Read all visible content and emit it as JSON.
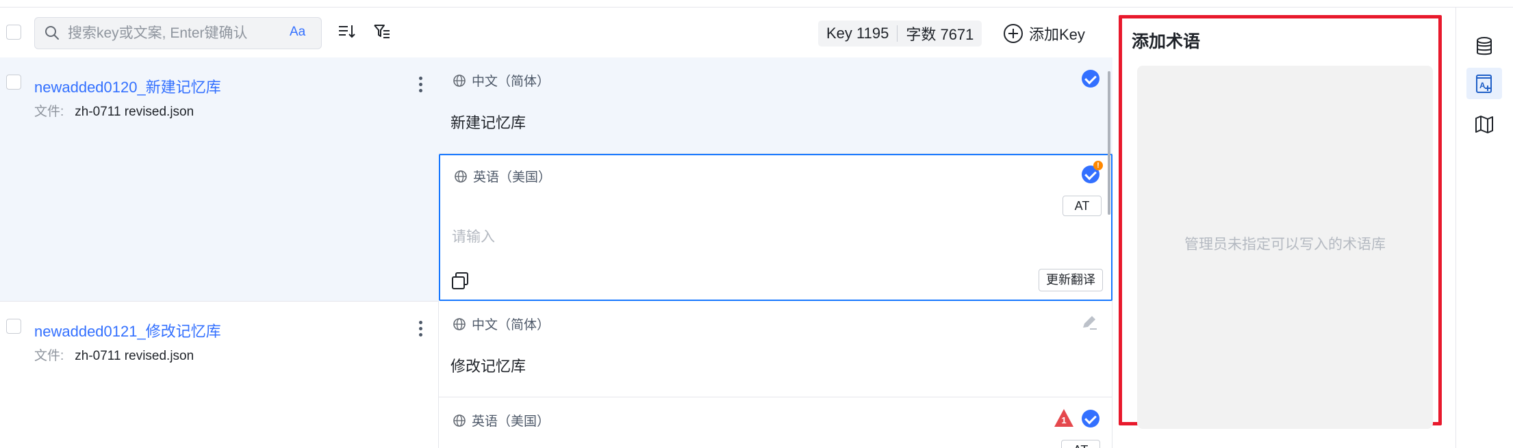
{
  "toolbar": {
    "search_placeholder": "搜索key或文案, Enter键确认",
    "case_toggle": "Aa",
    "key_count": "Key 1195",
    "word_count": "字数 7671",
    "add_key_label": "添加Key"
  },
  "keys": [
    {
      "name": "newadded0120_新建记忆库",
      "file_label": "文件:",
      "file": "zh-0711 revised.json"
    },
    {
      "name": "newadded0121_修改记忆库",
      "file_label": "文件:",
      "file": "zh-0711 revised.json"
    }
  ],
  "translations": {
    "row1_zh": {
      "lang": "中文（简体）",
      "value": "新建记忆库"
    },
    "row1_en": {
      "lang": "英语（美国）",
      "placeholder": "请输入",
      "at_button": "AT",
      "update_button": "更新翻译",
      "warning_count": "!"
    },
    "row2_zh": {
      "lang": "中文（简体）",
      "value": "修改记忆库"
    },
    "row2_en": {
      "lang": "英语（美国）",
      "at_button": "AT",
      "alert_count": "1"
    }
  },
  "glossary_panel": {
    "title": "添加术语",
    "empty_text": "管理员未指定可以写入的术语库"
  },
  "colors": {
    "accent": "#3370ff",
    "focus_border": "#1677ff",
    "panel_highlight": "#e8192c",
    "warning": "#ff8800",
    "alert": "#e5484d"
  },
  "icons": [
    "search-icon",
    "sort-icon",
    "filter-icon",
    "add-circle-icon",
    "globe-icon",
    "check-circle-icon",
    "copy-icon",
    "edit-icon",
    "alert-triangle-icon",
    "database-icon",
    "glossary-add-icon",
    "map-icon",
    "more-vertical-icon"
  ]
}
